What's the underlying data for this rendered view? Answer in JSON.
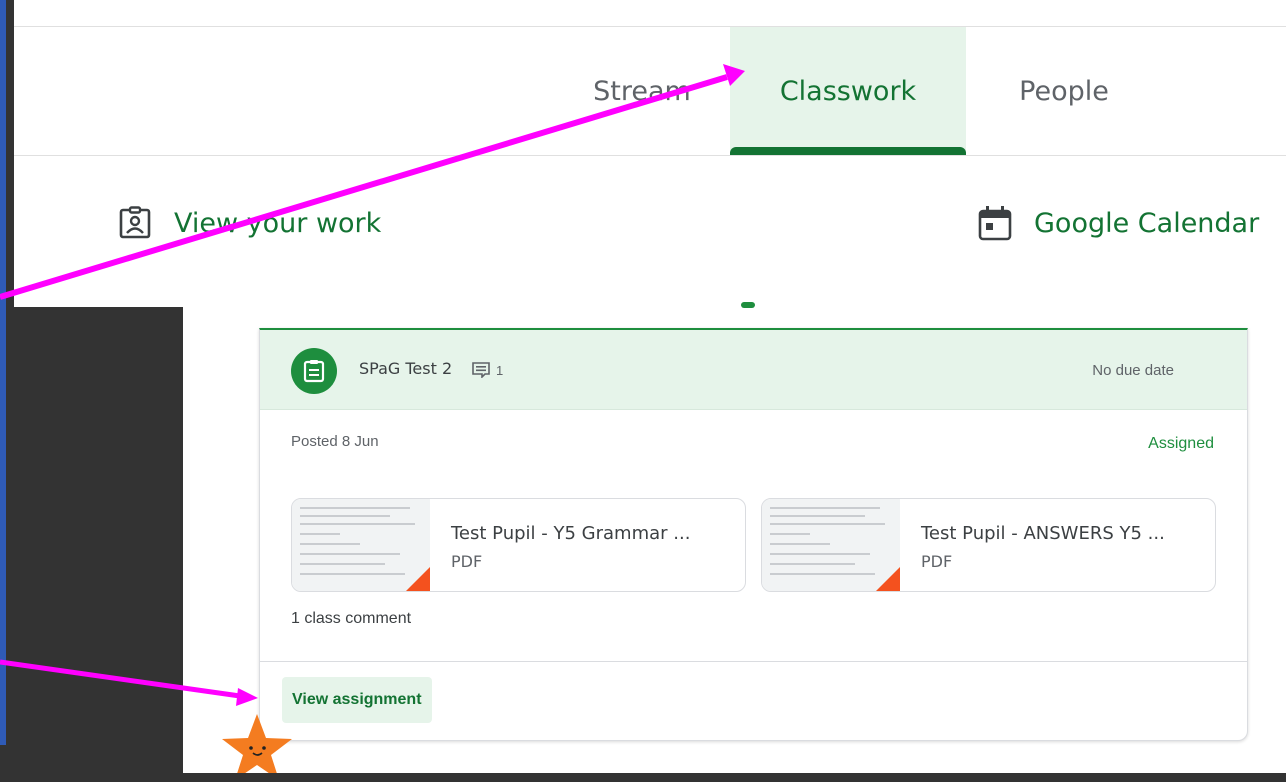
{
  "tabs": {
    "stream": "Stream",
    "classwork": "Classwork",
    "people": "People"
  },
  "toolbar": {
    "view_work": "View your work",
    "calendar": "Google Calendar"
  },
  "assignment": {
    "title": "SPaG Test 2",
    "comment_count": "1",
    "due": "No due date",
    "posted": "Posted 8 Jun",
    "status": "Assigned",
    "attachments": [
      {
        "title": "Test Pupil - Y5 Grammar ...",
        "type": "PDF"
      },
      {
        "title": "Test Pupil - ANSWERS Y5 ...",
        "type": "PDF"
      }
    ],
    "class_comment": "1 class comment",
    "view_button": "View assignment"
  },
  "colors": {
    "accent": "#137333",
    "accent_light": "#e6f4ea",
    "annotation_arrow": "#ff00ff",
    "star": "#f47c20"
  },
  "icons": [
    "assignment-ind-icon",
    "calendar-icon",
    "assignment-icon",
    "comment-icon",
    "star-sticker"
  ]
}
